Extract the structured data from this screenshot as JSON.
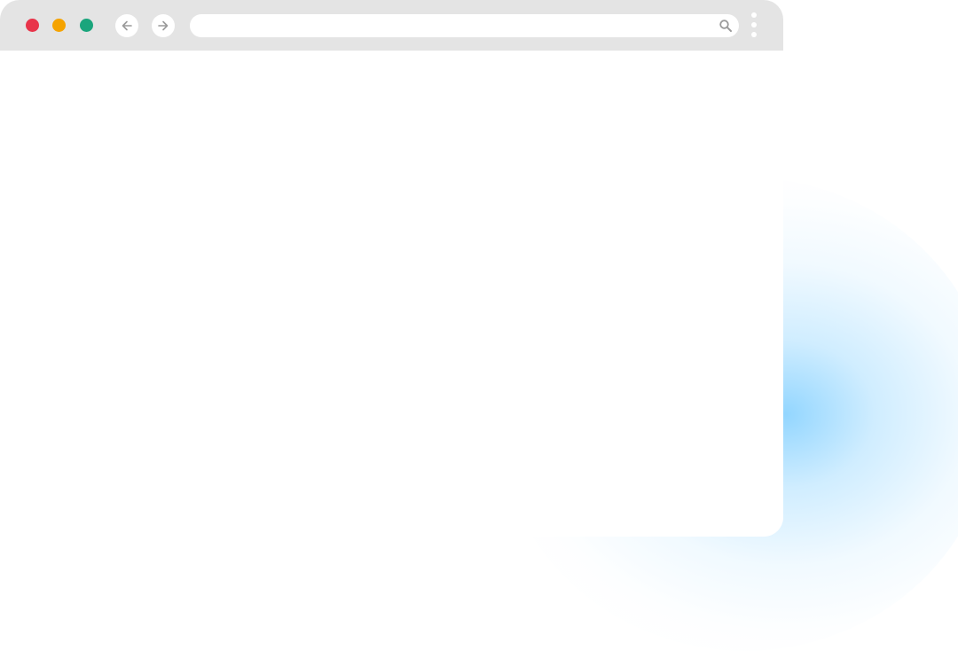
{
  "window": {
    "controls": {
      "close_color": "#e8344a",
      "minimize_color": "#f5a300",
      "maximize_color": "#1aa57c"
    },
    "nav": {
      "back_icon": "arrow-left-icon",
      "forward_icon": "arrow-right-icon"
    },
    "address_bar": {
      "value": "",
      "placeholder": "",
      "icon": "search-icon"
    },
    "menu_icon": "kebab-menu-icon",
    "content": ""
  },
  "colors": {
    "titlebar": "#e4e4e4",
    "glow": "#6ec8ff",
    "icon_gray": "#9a9a9a"
  }
}
